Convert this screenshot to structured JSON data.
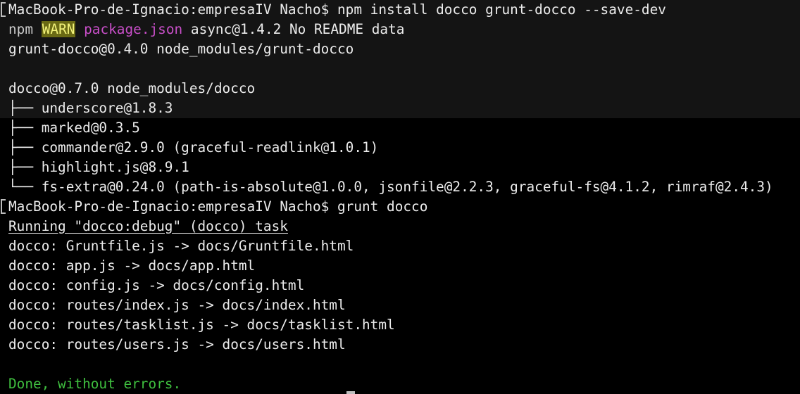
{
  "terminal": {
    "lines": [
      {
        "kind": "prompt",
        "prompt": "MacBook-Pro-de-Ignacio:empresaIV Nacho$",
        "command": "npm install docco grunt-docco --save-dev"
      },
      {
        "kind": "warn",
        "npm": "npm",
        "badge": "WARN",
        "file": "package.json",
        "message": "async@1.4.2 No README data"
      },
      {
        "kind": "text",
        "text": "grunt-docco@0.4.0 node_modules/grunt-docco"
      },
      {
        "kind": "blank",
        "text": ""
      },
      {
        "kind": "text",
        "text": "docco@0.7.0 node_modules/docco"
      },
      {
        "kind": "text",
        "text": "├── underscore@1.8.3"
      },
      {
        "kind": "text",
        "text": "├── marked@0.3.5"
      },
      {
        "kind": "text",
        "text": "├── commander@2.9.0 (graceful-readlink@1.0.1)"
      },
      {
        "kind": "text",
        "text": "├── highlight.js@8.9.1"
      },
      {
        "kind": "text",
        "text": "└── fs-extra@0.24.0 (path-is-absolute@1.0.0, jsonfile@2.2.3, graceful-fs@4.1.2, rimraf@2.4.3)"
      },
      {
        "kind": "prompt",
        "prompt": "MacBook-Pro-de-Ignacio:empresaIV Nacho$",
        "command": "grunt docco"
      },
      {
        "kind": "task",
        "text": "Running \"docco:debug\" (docco) task"
      },
      {
        "kind": "text",
        "text": "docco: Gruntfile.js -> docs/Gruntfile.html"
      },
      {
        "kind": "text",
        "text": "docco: app.js -> docs/app.html"
      },
      {
        "kind": "text",
        "text": "docco: config.js -> docs/config.html"
      },
      {
        "kind": "text",
        "text": "docco: routes/index.js -> docs/index.html"
      },
      {
        "kind": "text",
        "text": "docco: routes/tasklist.js -> docs/tasklist.html"
      },
      {
        "kind": "text",
        "text": "docco: routes/users.js -> docs/users.html"
      },
      {
        "kind": "blank",
        "text": ""
      },
      {
        "kind": "done",
        "text": "Done, without errors."
      }
    ]
  },
  "colors": {
    "background": "#000000",
    "foreground": "#ececec",
    "warn_badge_bg": "#6a6a14",
    "warn_badge_fg": "#f2f27a",
    "package_magenta": "#c94fc9",
    "done_green": "#3fbf3f"
  }
}
